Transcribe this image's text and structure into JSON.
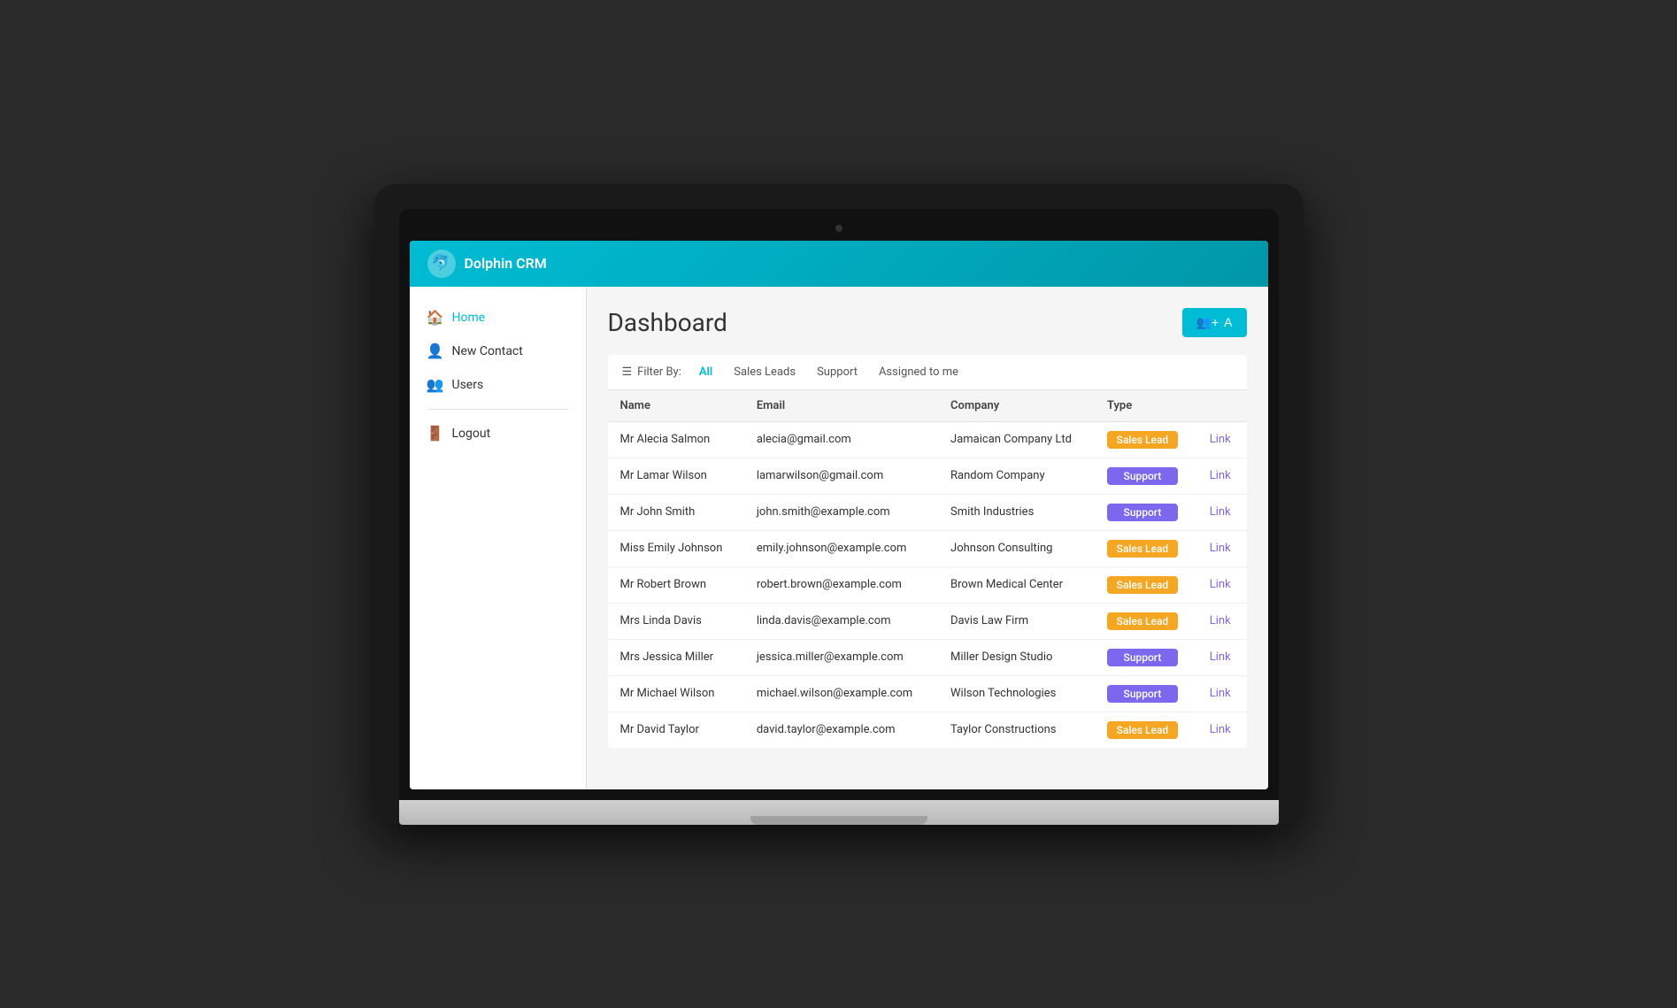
{
  "app": {
    "title": "Dolphin CRM",
    "logo_icon": "🐬"
  },
  "sidebar": {
    "items": [
      {
        "id": "home",
        "label": "Home",
        "icon": "🏠",
        "active": true
      },
      {
        "id": "new-contact",
        "label": "New Contact",
        "icon": "👤"
      },
      {
        "id": "users",
        "label": "Users",
        "icon": "👥"
      },
      {
        "id": "logout",
        "label": "Logout",
        "icon": "🚪"
      }
    ]
  },
  "dashboard": {
    "title": "Dashboard",
    "add_button_label": "A",
    "filter": {
      "label": "Filter By:",
      "tabs": [
        {
          "id": "all",
          "label": "All",
          "active": true
        },
        {
          "id": "sales-leads",
          "label": "Sales Leads",
          "active": false
        },
        {
          "id": "support",
          "label": "Support",
          "active": false
        },
        {
          "id": "assigned-me",
          "label": "Assigned to me",
          "active": false
        }
      ]
    },
    "table": {
      "columns": [
        "Name",
        "Email",
        "Company",
        "Type",
        ""
      ],
      "rows": [
        {
          "name": "Mr Alecia Salmon",
          "email": "alecia@gmail.com",
          "company": "Jamaican Company Ltd",
          "type": "Sales Lead",
          "type_class": "sales",
          "link": "Link"
        },
        {
          "name": "Mr Lamar Wilson",
          "email": "lamarwilson@gmail.com",
          "company": "Random Company",
          "type": "Support",
          "type_class": "support",
          "link": "Link"
        },
        {
          "name": "Mr John Smith",
          "email": "john.smith@example.com",
          "company": "Smith Industries",
          "type": "Support",
          "type_class": "support",
          "link": "Link"
        },
        {
          "name": "Miss Emily Johnson",
          "email": "emily.johnson@example.com",
          "company": "Johnson Consulting",
          "type": "Sales Lead",
          "type_class": "sales",
          "link": "Link"
        },
        {
          "name": "Mr Robert Brown",
          "email": "robert.brown@example.com",
          "company": "Brown Medical Center",
          "type": "Sales Lead",
          "type_class": "sales",
          "link": "Link"
        },
        {
          "name": "Mrs Linda Davis",
          "email": "linda.davis@example.com",
          "company": "Davis Law Firm",
          "type": "Sales Lead",
          "type_class": "sales",
          "link": "Link"
        },
        {
          "name": "Mrs Jessica Miller",
          "email": "jessica.miller@example.com",
          "company": "Miller Design Studio",
          "type": "Support",
          "type_class": "support",
          "link": "Link"
        },
        {
          "name": "Mr Michael Wilson",
          "email": "michael.wilson@example.com",
          "company": "Wilson Technologies",
          "type": "Support",
          "type_class": "support",
          "link": "Link"
        },
        {
          "name": "Mr David Taylor",
          "email": "david.taylor@example.com",
          "company": "Taylor Constructions",
          "type": "Sales Lead",
          "type_class": "sales",
          "link": "Link"
        }
      ]
    }
  }
}
